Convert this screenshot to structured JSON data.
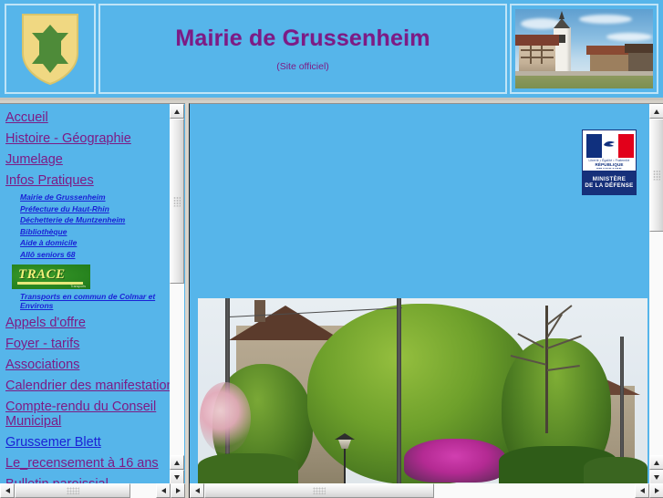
{
  "header": {
    "blason_alt": "coat-of-arms",
    "title": "Mairie de Grussenheim",
    "subtitle": "(Site officiel)",
    "photo_alt": "village-church-photo",
    "background_color": "#56b5ea",
    "title_color": "#7d1b85",
    "border_color": "#bfe4f7"
  },
  "sidebar": {
    "links": [
      {
        "label": "Accueil",
        "state": "visited"
      },
      {
        "label": "Histoire - Géographie",
        "state": "visited"
      },
      {
        "label": "Jumelage",
        "state": "visited"
      },
      {
        "label": "Infos Pratiques",
        "state": "visited"
      }
    ],
    "sublinks": [
      {
        "label": "Mairie de Grussenheim"
      },
      {
        "label": "Préfecture du Haut-Rhin"
      },
      {
        "label": "Déchetterie de Muntzenheim"
      },
      {
        "label": "Bibliothèque"
      },
      {
        "label": "Aide à domicile"
      },
      {
        "label": "Allô seniors 68"
      }
    ],
    "logo": {
      "name": "trace-logo",
      "text": "TRACE",
      "subtext": "Transports",
      "background_color": "#2d8a22",
      "text_color": "#f2f07a"
    },
    "logo_caption": "Transports en commun de Colmar et Environs",
    "links_after": [
      {
        "label": "Appels d'offre",
        "state": "visited"
      },
      {
        "label": "Foyer - tarifs",
        "state": "visited"
      },
      {
        "label": "Associations",
        "state": "visited"
      },
      {
        "label": "Calendrier des manifestations",
        "state": "visited"
      },
      {
        "label": "Compte-rendu du Conseil Municipal",
        "state": "visited"
      },
      {
        "label": "Grussemer Blett",
        "state": "unvisited"
      },
      {
        "label": "Le_recensement à 16 ans",
        "state": "visited"
      },
      {
        "label": "Bulletin paroissial",
        "state": "visited"
      }
    ],
    "link_visited_color": "#7d1b85",
    "link_unvisited_color": "#1a22d6"
  },
  "main": {
    "defense_badge": {
      "flag_alt": "french-flag-marianne",
      "republic_line1": "Liberté • Égalité • Fraternité",
      "republic_line2": "RÉPUBLIQUE FRANÇAISE",
      "ministry_line1": "MINISTÈRE",
      "ministry_line2": "DE LA DÉFENSE",
      "flag_blue": "#10307e",
      "flag_red": "#e2001a",
      "panel_blue": "#16307a"
    },
    "photo_alt": "grussenheim-street-with-house-trees-and-flowers",
    "background_color": "#56b5ea"
  },
  "scrollbars": {
    "left_vertical": {
      "name": "left-frame-vertical-scrollbar",
      "up": "▲",
      "down": "▼"
    },
    "left_horizontal": {
      "name": "left-frame-horizontal-scrollbar",
      "left": "◀",
      "right": "▶"
    },
    "main_vertical": {
      "name": "main-frame-vertical-scrollbar",
      "up": "▲",
      "down": "▼"
    },
    "main_horizontal": {
      "name": "main-frame-horizontal-scrollbar",
      "left": "◀",
      "right": "▶"
    }
  }
}
